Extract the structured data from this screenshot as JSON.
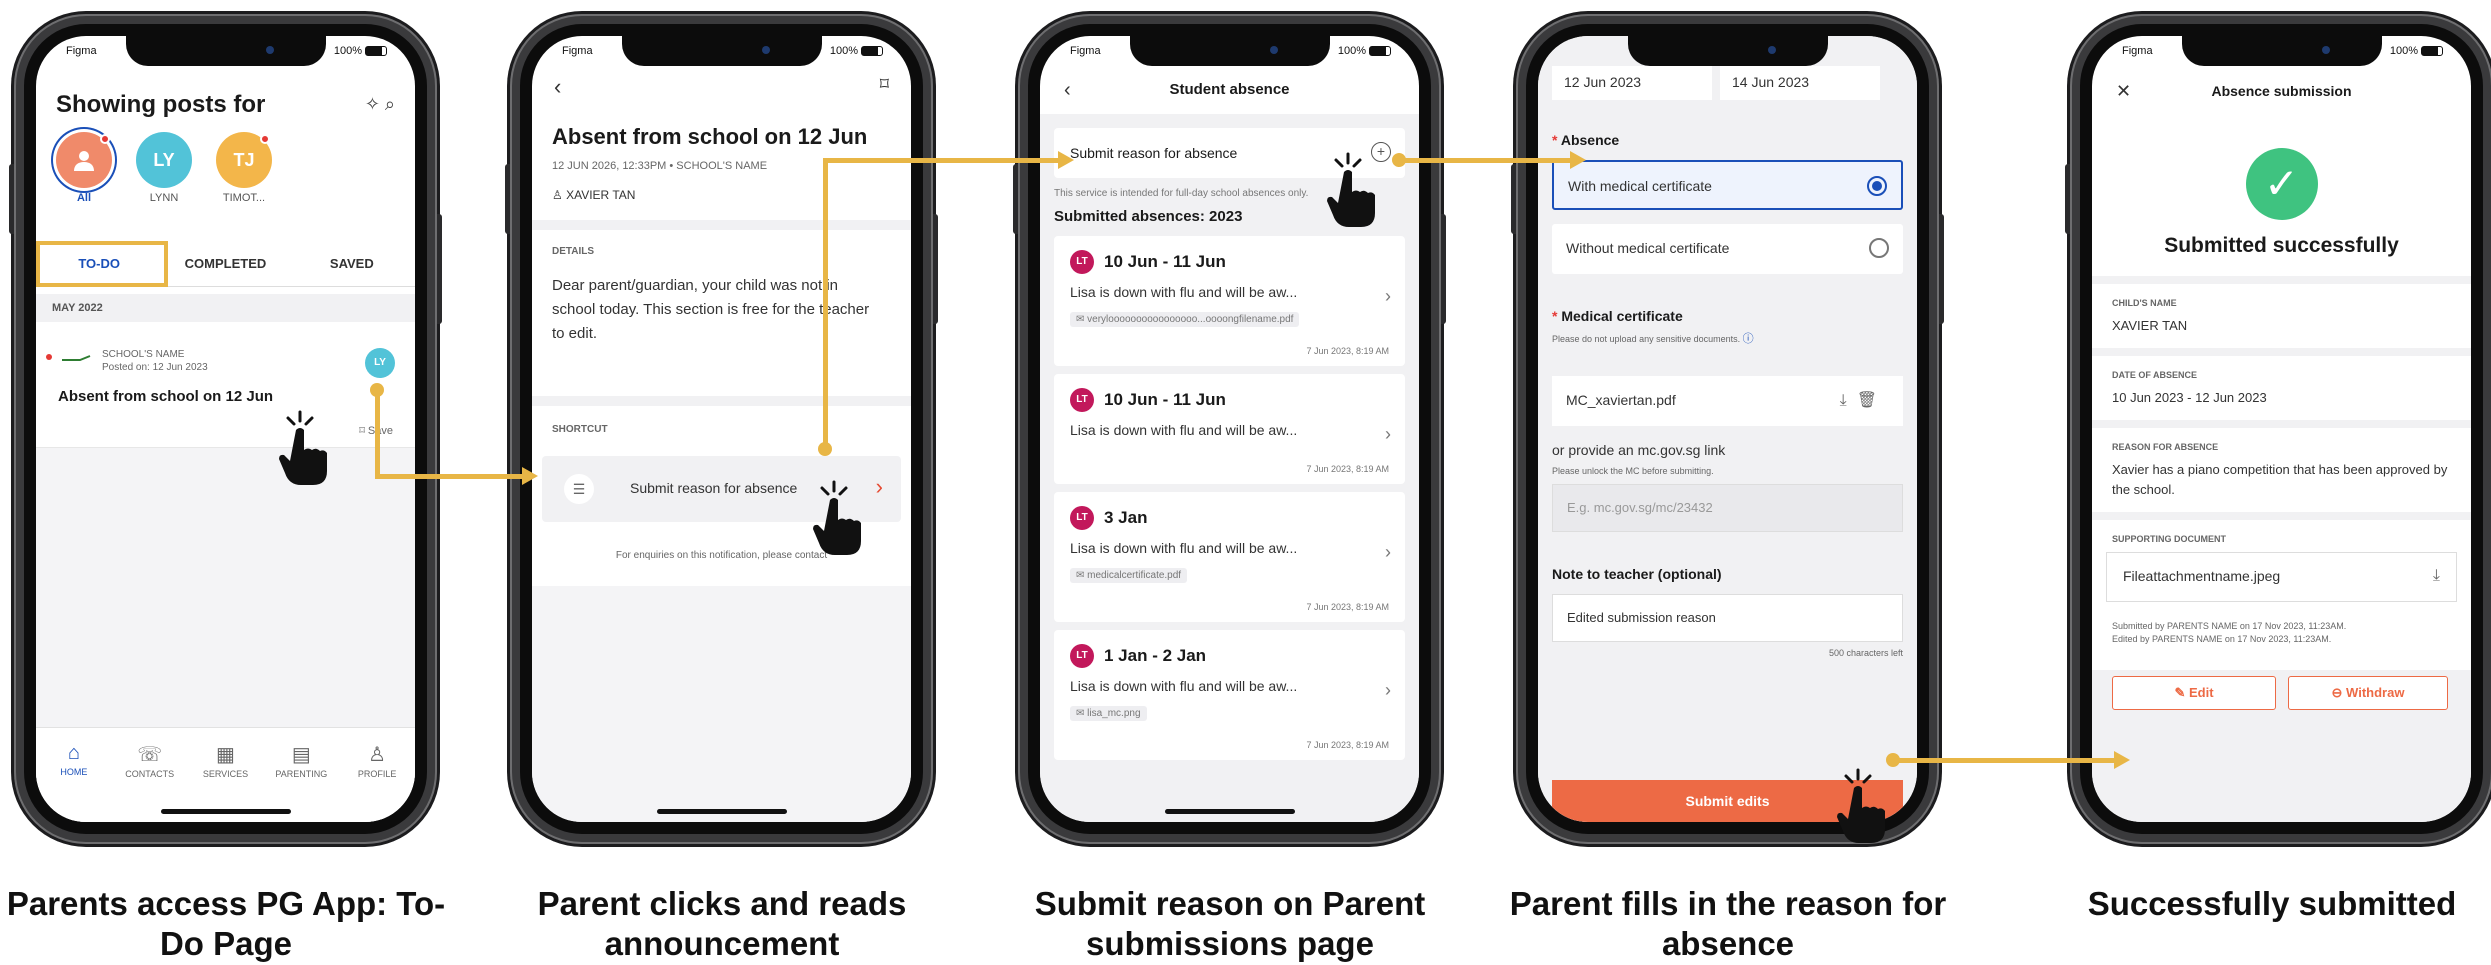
{
  "status": {
    "carrier": "Figma",
    "battery": "100%"
  },
  "phone1": {
    "title": "Showing posts for",
    "icons": "✧ ⌕",
    "avatars": [
      {
        "initials": "",
        "label": "All",
        "color": "#f08a6a"
      },
      {
        "initials": "LY",
        "label": "LYNN",
        "color": "#52c3d8"
      },
      {
        "initials": "TJ",
        "label": "TIMOT...",
        "color": "#f3b64a"
      }
    ],
    "tabs": [
      "TO-DO",
      "COMPLETED",
      "SAVED"
    ],
    "section": "MAY 2022",
    "post": {
      "school": "SCHOOL'S NAME",
      "posted": "Posted on: 12 Jun 2023",
      "title": "Absent from school on 12 Jun",
      "save": "Save",
      "avatar": "LY"
    },
    "nav": [
      {
        "icon": "⌂",
        "label": "HOME"
      },
      {
        "icon": "☏",
        "label": "CONTACTS"
      },
      {
        "icon": "▦",
        "label": "SERVICES"
      },
      {
        "icon": "▤",
        "label": "PARENTING"
      },
      {
        "icon": "♙",
        "label": "PROFILE"
      }
    ]
  },
  "phone2": {
    "back": "‹",
    "bookmark": "⌑",
    "title": "Absent from school on 12 Jun",
    "meta": "12 JUN 2026, 12:33PM  •  SCHOOL'S NAME",
    "person": "XAVIER TAN",
    "details_label": "DETAILS",
    "body": "Dear parent/guardian, your child was not in school today. This section is free for the teacher to edit.",
    "shortcut_label": "SHORTCUT",
    "shortcut_text": "Submit reason for absence",
    "enquiry": "For enquiries on this notification, please contact"
  },
  "phone3": {
    "back": "‹",
    "title": "Student absence",
    "submit": "Submit reason for absence",
    "note": "This service is intended for full-day school absences only.",
    "heading": "Submitted absences: 2023",
    "cards": [
      {
        "initials": "LT",
        "dates": "10 Jun - 11 Jun",
        "reason": "Lisa is down with flu and will be aw...",
        "file": "✉ veryloooooooooooooooo...oooongfilename.pdf",
        "ts": "7 Jun 2023, 8:19 AM"
      },
      {
        "initials": "LT",
        "dates": "10 Jun - 11 Jun",
        "reason": "Lisa is down with flu and will be aw...",
        "file": "",
        "ts": "7 Jun 2023, 8:19 AM"
      },
      {
        "initials": "LT",
        "dates": "3 Jan",
        "reason": "Lisa is down with flu and will be aw...",
        "file": "✉ medicalcertificate.pdf",
        "ts": "7 Jun 2023, 8:19 AM"
      },
      {
        "initials": "LT",
        "dates": "1 Jan - 2 Jan",
        "reason": "Lisa is down with flu and will be aw...",
        "file": "✉ lisa_mc.png",
        "ts": "7 Jun 2023, 8:19 AM"
      }
    ]
  },
  "phone4": {
    "date_from": "12 Jun 2023",
    "date_to": "14 Jun 2023",
    "absence_label": "Absence",
    "option1": "With medical certificate",
    "option2": "Without medical certificate",
    "mc_label": "Medical certificate",
    "mc_note": "Please do not upload any sensitive documents.",
    "file": "MC_xaviertan.pdf",
    "link_text": "or provide an mc.gov.sg link",
    "link_note": "Please unlock the MC before submitting.",
    "link_placeholder": "E.g. mc.gov.sg/mc/23432",
    "note_label": "Note to teacher (optional)",
    "note_value": "Edited submission reason",
    "count": "500 characters left",
    "button": "Submit edits"
  },
  "phone5": {
    "close": "✕",
    "title": "Absence submission",
    "success": "Submitted successfully",
    "child_label": "CHILD'S NAME",
    "child": "XAVIER TAN",
    "date_label": "DATE OF ABSENCE",
    "date": "10 Jun 2023 - 12 Jun 2023",
    "reason_label": "REASON FOR ABSENCE",
    "reason": "Xavier has a piano competition that has been approved by the school.",
    "doc_label": "SUPPORTING DOCUMENT",
    "doc": "Fileattachmentname.jpeg",
    "submitted": "Submitted by PARENTS NAME on 17 Nov 2023, 11:23AM.",
    "edited": "Edited by PARENTS NAME on 17 Nov 2023, 11:23AM.",
    "edit": "✎ Edit",
    "withdraw": "⊖ Withdraw"
  },
  "captions": [
    "Parents access PG App: To-Do Page",
    "Parent clicks and reads announcement",
    "Submit reason on Parent submissions page",
    "Parent fills in the reason for absence",
    "Successfully submitted"
  ],
  "colors": {
    "accent": "#e8b646",
    "primary": "#1a4fb8",
    "action": "#ed6a45",
    "success": "#3fc380"
  }
}
